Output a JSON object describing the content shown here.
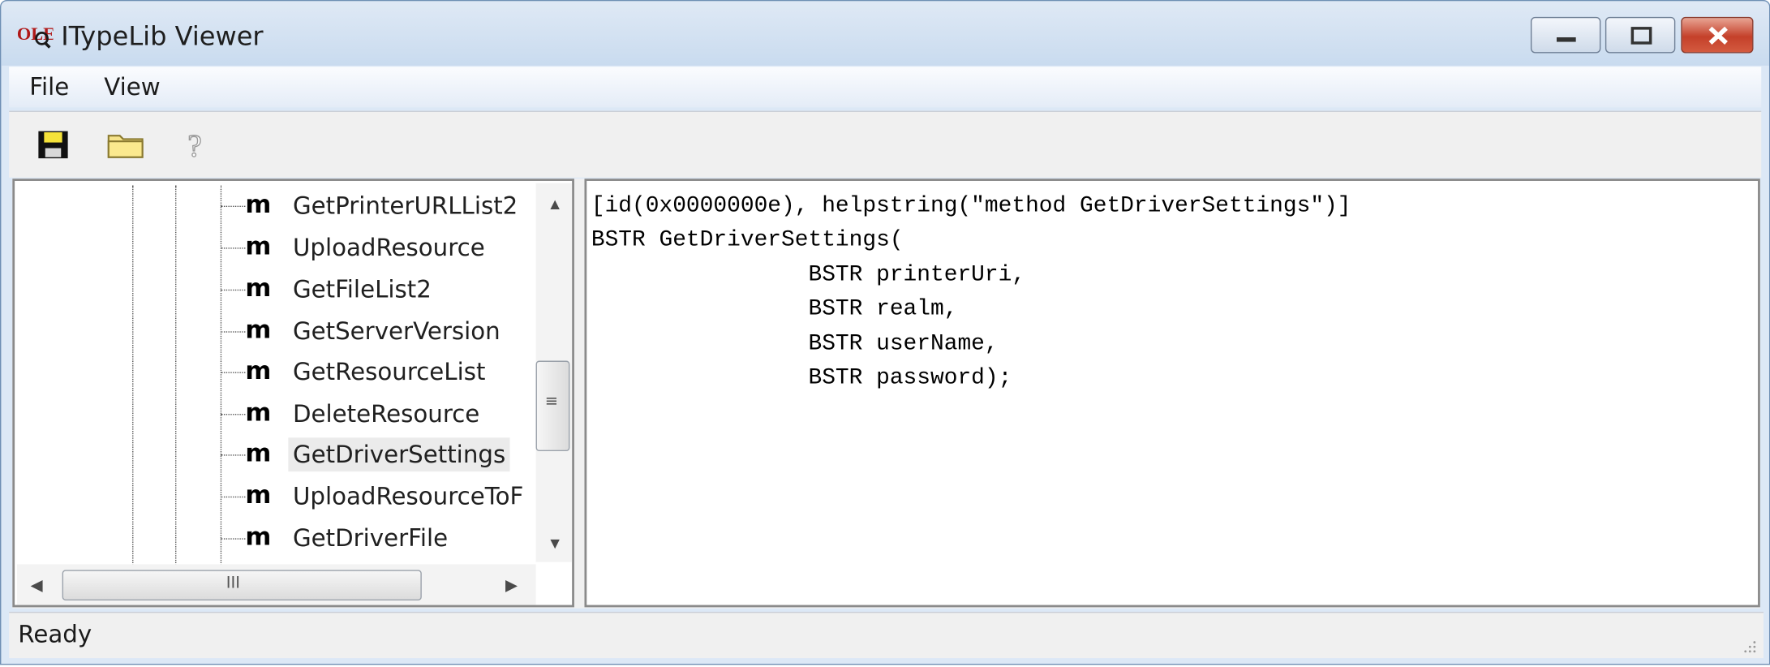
{
  "window": {
    "title": "ITypeLib Viewer",
    "app_icon_text": "OLE"
  },
  "menu": {
    "items": [
      "File",
      "View"
    ]
  },
  "toolbar": {
    "buttons": [
      "save-icon",
      "open-folder-icon",
      "help-icon"
    ]
  },
  "tree": {
    "items": [
      {
        "icon": "m",
        "label": "GetPrinterURLList2",
        "selected": false
      },
      {
        "icon": "m",
        "label": "UploadResource",
        "selected": false
      },
      {
        "icon": "m",
        "label": "GetFileList2",
        "selected": false
      },
      {
        "icon": "m",
        "label": "GetServerVersion",
        "selected": false
      },
      {
        "icon": "m",
        "label": "GetResourceList",
        "selected": false
      },
      {
        "icon": "m",
        "label": "DeleteResource",
        "selected": false
      },
      {
        "icon": "m",
        "label": "GetDriverSettings",
        "selected": true
      },
      {
        "icon": "m",
        "label": "UploadResourceToF",
        "selected": false
      },
      {
        "icon": "m",
        "label": "GetDriverFile",
        "selected": false
      }
    ],
    "hscroll_thumb_glyph": "III"
  },
  "detail": {
    "lines": [
      "[id(0x0000000e), helpstring(\"method GetDriverSettings\")]",
      "BSTR GetDriverSettings(",
      "                BSTR printerUri,",
      "                BSTR realm,",
      "                BSTR userName,",
      "                BSTR password);"
    ]
  },
  "status": {
    "text": "Ready"
  }
}
